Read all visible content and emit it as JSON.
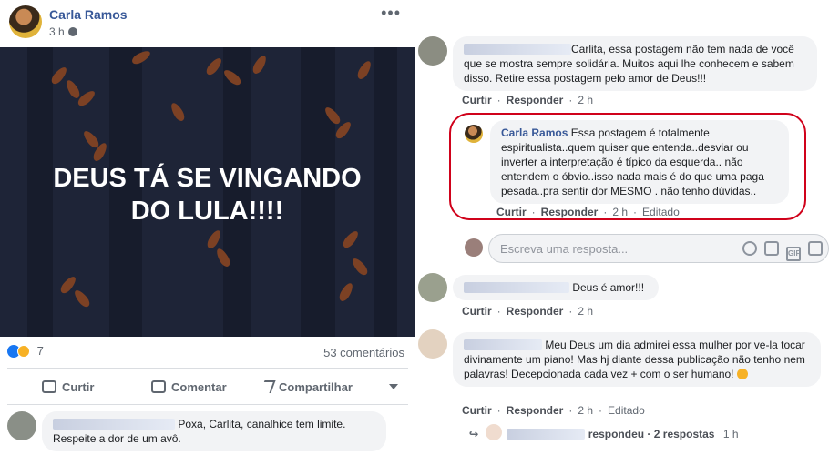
{
  "post": {
    "author": "Carla Ramos",
    "time": "3 h",
    "more_icon": "more-horizontal-icon",
    "image_text": "DEUS TÁ SE VINGANDO DO LULA!!!!",
    "reactions_count": "7",
    "comments_count": "53 comentários",
    "actions": {
      "like": "Curtir",
      "comment": "Comentar",
      "share": "Compartilhar"
    }
  },
  "left_comment": {
    "text_line1": "Poxa, Carlita, canalhice tem limite.",
    "text_line2": "Respeite a dor de um avô."
  },
  "comments": [
    {
      "text": "Carlita, essa postagem não tem nada de você que se mostra sempre solidária. Muitos aqui lhe conhecem e sabem disso. Retire essa postagem pelo amor de Deus!!!",
      "like": "Curtir",
      "reply": "Responder",
      "time": "2 h"
    },
    {
      "author": "Carla Ramos",
      "text": "Essa postagem é totalmente espiritualista..quem quiser que entenda..desviar ou inverter a interpretação é típico da esquerda.. não entendem o óbvio..isso nada mais é do que uma paga pesada..pra sentir dor MESMO . não tenho dúvidas..",
      "like": "Curtir",
      "reply": "Responder",
      "time": "2 h",
      "edited": "Editado"
    },
    {
      "text": "Deus é amor!!!",
      "like": "Curtir",
      "reply": "Responder",
      "time": "2 h"
    },
    {
      "text": "Meu Deus um dia admirei essa mulher por ve-la tocar divinamente um piano! Mas hj diante dessa publicação não tenho nem palavras! Decepcionada cada vez + com o ser humano!",
      "like": "Curtir",
      "reply": "Responder",
      "time": "2 h",
      "edited": "Editado"
    }
  ],
  "reply_input": {
    "placeholder": "Escreva uma resposta..."
  },
  "replies_summary": {
    "action": "respondeu",
    "count": "2 respostas",
    "time": "1 h"
  },
  "colors": {
    "brand_link": "#385898",
    "highlight": "#d0021b",
    "image_bg": "#1e2437",
    "leaf": "#7c4124"
  }
}
